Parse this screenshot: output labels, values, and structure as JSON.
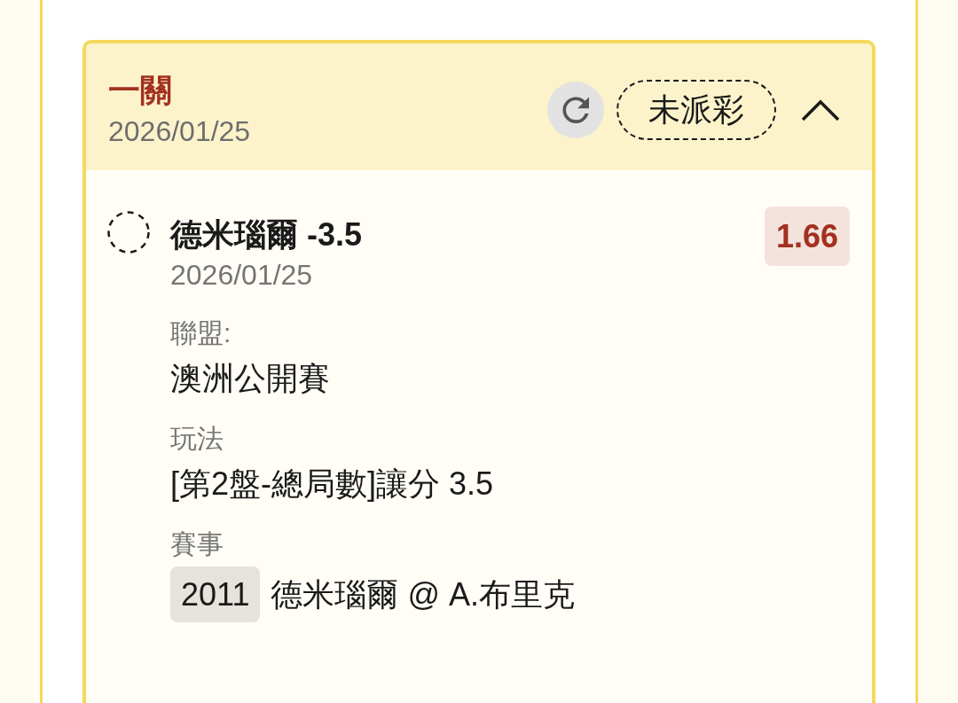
{
  "ticket": {
    "title": "一關",
    "date": "2026/01/25",
    "status": "未派彩",
    "expanded": true,
    "selections": [
      {
        "title": "德米瑙爾 -3.5",
        "date": "2026/01/25",
        "odds": "1.66",
        "fields": [
          {
            "kind": "text",
            "label": "聯盟:",
            "value": "澳洲公開賽"
          },
          {
            "kind": "text",
            "label": "玩法",
            "value": "[第2盤-總局數]讓分 3.5"
          },
          {
            "kind": "event",
            "label": "賽事",
            "code": "2011",
            "value": "德米瑙爾 @ A.布里克"
          }
        ]
      }
    ]
  }
}
